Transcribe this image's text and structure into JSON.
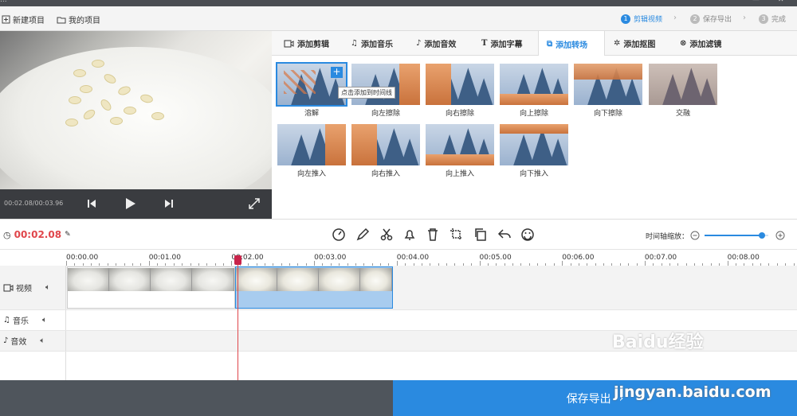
{
  "app": {
    "title": "...",
    "window_controls": [
      "—",
      "✕"
    ]
  },
  "menu": {
    "new_project": "新建项目",
    "my_project": "我的项目"
  },
  "steps": [
    {
      "num": "1",
      "label": "剪辑视频"
    },
    {
      "num": "2",
      "label": "保存导出"
    },
    {
      "num": "3",
      "label": "完成"
    }
  ],
  "player": {
    "timecode": "00:02.08/00:03.96"
  },
  "tabs": [
    "添加剪辑",
    "添加音乐",
    "添加音效",
    "添加字幕",
    "添加转场",
    "添加抠图",
    "添加滤镜"
  ],
  "active_tab": "添加转场",
  "transitions": [
    "溶解",
    "向左擦除",
    "向右擦除",
    "向上擦除",
    "向下擦除",
    "交融",
    "向左推入",
    "向右推入",
    "向上推入",
    "向下推入"
  ],
  "tooltip": "点击添加到时间线",
  "plus_label": "+",
  "current_time": "00:02.08",
  "zoom_label": "时间轴缩放：",
  "zoom_level": 0.9,
  "ruler": [
    "00:00.00",
    "00:01.00",
    "00:02.00",
    "00:03.00",
    "00:04.00",
    "00:05.00",
    "00:06.00",
    "00:07.00",
    "00:08.00"
  ],
  "tracks": {
    "video": "视频",
    "music": "音乐",
    "effect": "音效"
  },
  "export_label": "保存导出",
  "watermark": {
    "line1": "Baidu经验",
    "line2": "jingyan.baidu.com"
  },
  "colors": {
    "accent": "#2a8ae0",
    "playhead": "#e0464b",
    "footer": "#4f555c"
  }
}
